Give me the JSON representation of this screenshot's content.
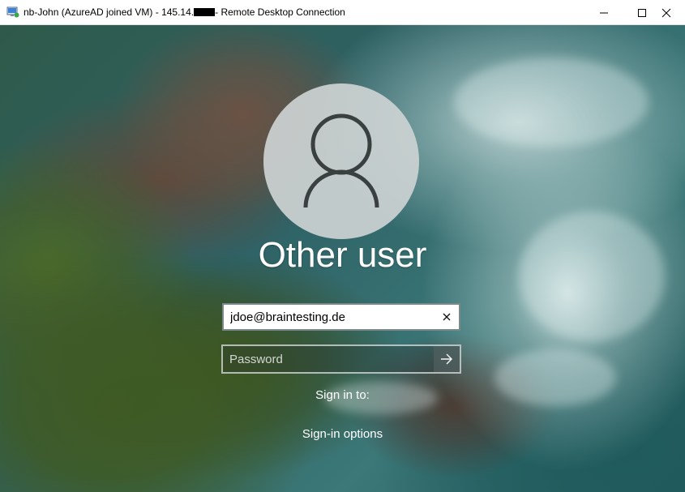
{
  "window": {
    "title_prefix": "nb-John (AzureAD joined VM) - 145.14.",
    "title_suffix": "- Remote Desktop Connection",
    "icons": {
      "app": "remote-desktop-icon",
      "minimize": "minimize-icon",
      "maximize": "maximize-icon",
      "close": "close-icon"
    }
  },
  "login": {
    "avatar_icon": "user-icon",
    "username": "Other user",
    "email_value": "jdoe@braintesting.de",
    "clear_icon": "clear-x-icon",
    "password_placeholder": "Password",
    "submit_icon": "arrow-right-icon",
    "sign_in_to": "Sign in to:",
    "signin_options": "Sign-in options"
  }
}
